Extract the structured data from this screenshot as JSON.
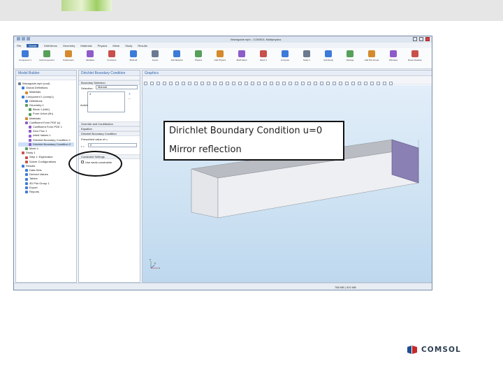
{
  "app": {
    "title": "Waveguide.mph - COMSOL Multiphysics",
    "menu_tabs": [
      "File",
      "Home",
      "Definitions",
      "Geometry",
      "Materials",
      "Physics",
      "Mesh",
      "Study",
      "Results"
    ],
    "active_tab": "Home",
    "ribbon_buttons": [
      "Component 1",
      "Add Component",
      "Parameters",
      "Variables",
      "Functions",
      "Build All",
      "Import",
      "Add Material",
      "Physics",
      "Add Physics",
      "Build Mesh",
      "Mesh 1",
      "Compute",
      "Study 1",
      "Add Study",
      "Settings",
      "Add Plot Group",
      "Windows",
      "Reset Desktop"
    ],
    "status": "788 MB | 920 MB"
  },
  "model_builder": {
    "title": "Model Builder",
    "tree": [
      {
        "label": "Waveguide.mph (root)",
        "indent": 0,
        "color": "#6b7a90"
      },
      {
        "label": "Global Definitions",
        "indent": 1,
        "color": "#3d7bd9"
      },
      {
        "label": "Materials",
        "indent": 2,
        "color": "#d48a2c"
      },
      {
        "label": "Component 1 (comp1)",
        "indent": 1,
        "color": "#3d7bd9"
      },
      {
        "label": "Definitions",
        "indent": 2,
        "color": "#3d7bd9"
      },
      {
        "label": "Geometry 1",
        "indent": 2,
        "color": "#57a05a"
      },
      {
        "label": "Block 1 (blk1)",
        "indent": 3,
        "color": "#57a05a"
      },
      {
        "label": "Form Union (fin)",
        "indent": 3,
        "color": "#57a05a"
      },
      {
        "label": "Materials",
        "indent": 2,
        "color": "#d48a2c"
      },
      {
        "label": "Coefficient Form PDE (c)",
        "indent": 2,
        "color": "#8e5cc9"
      },
      {
        "label": "Coefficient Form PDE 1",
        "indent": 3,
        "color": "#8e5cc9"
      },
      {
        "label": "Zero Flux 1",
        "indent": 3,
        "color": "#8e5cc9"
      },
      {
        "label": "Initial Values 1",
        "indent": 3,
        "color": "#8e5cc9"
      },
      {
        "label": "Dirichlet Boundary Condition 1",
        "indent": 3,
        "color": "#8e5cc9"
      },
      {
        "label": "Dirichlet Boundary Condition 2",
        "indent": 3,
        "color": "#8e5cc9",
        "selected": true
      },
      {
        "label": "Mesh 1",
        "indent": 2,
        "color": "#57a05a"
      },
      {
        "label": "Study 1",
        "indent": 1,
        "color": "#c9504a"
      },
      {
        "label": "Step 1: Eigenvalue",
        "indent": 2,
        "color": "#c9504a"
      },
      {
        "label": "Solver Configurations",
        "indent": 2,
        "color": "#c9504a"
      },
      {
        "label": "Results",
        "indent": 1,
        "color": "#3d7bd9"
      },
      {
        "label": "Data Sets",
        "indent": 2,
        "color": "#3d7bd9"
      },
      {
        "label": "Derived Values",
        "indent": 2,
        "color": "#3d7bd9"
      },
      {
        "label": "Tables",
        "indent": 2,
        "color": "#3d7bd9"
      },
      {
        "label": "3D Plot Group 1",
        "indent": 2,
        "color": "#3d7bd9"
      },
      {
        "label": "Export",
        "indent": 2,
        "color": "#3d7bd9"
      },
      {
        "label": "Reports",
        "indent": 2,
        "color": "#3d7bd9"
      }
    ]
  },
  "settings_panel": {
    "title": "Dirichlet Boundary Condition",
    "section_selection": "Boundary Selection",
    "selection_label": "Selection:",
    "selection_value": "Manual",
    "list_item": "4",
    "active_label": "Active",
    "section_override": "Override and Contribution",
    "section_equation": "Equation",
    "section_dirichlet": "Dirichlet Boundary Condition",
    "prescribed_label": "Prescribed value of u",
    "r_label": "r =",
    "r_value": "0",
    "section_constraint": "Constraint Settings",
    "constraint_value": "Use weak constraints"
  },
  "graphics": {
    "title": "Graphics",
    "axis_labels": [
      "x",
      "y",
      "z"
    ]
  },
  "callout": {
    "line1": "Dirichlet Boundary Condition u=0",
    "line2": "Mirror reflection"
  },
  "logo": {
    "text": "COMSOL",
    "mark_color": "#1f4e8c"
  }
}
